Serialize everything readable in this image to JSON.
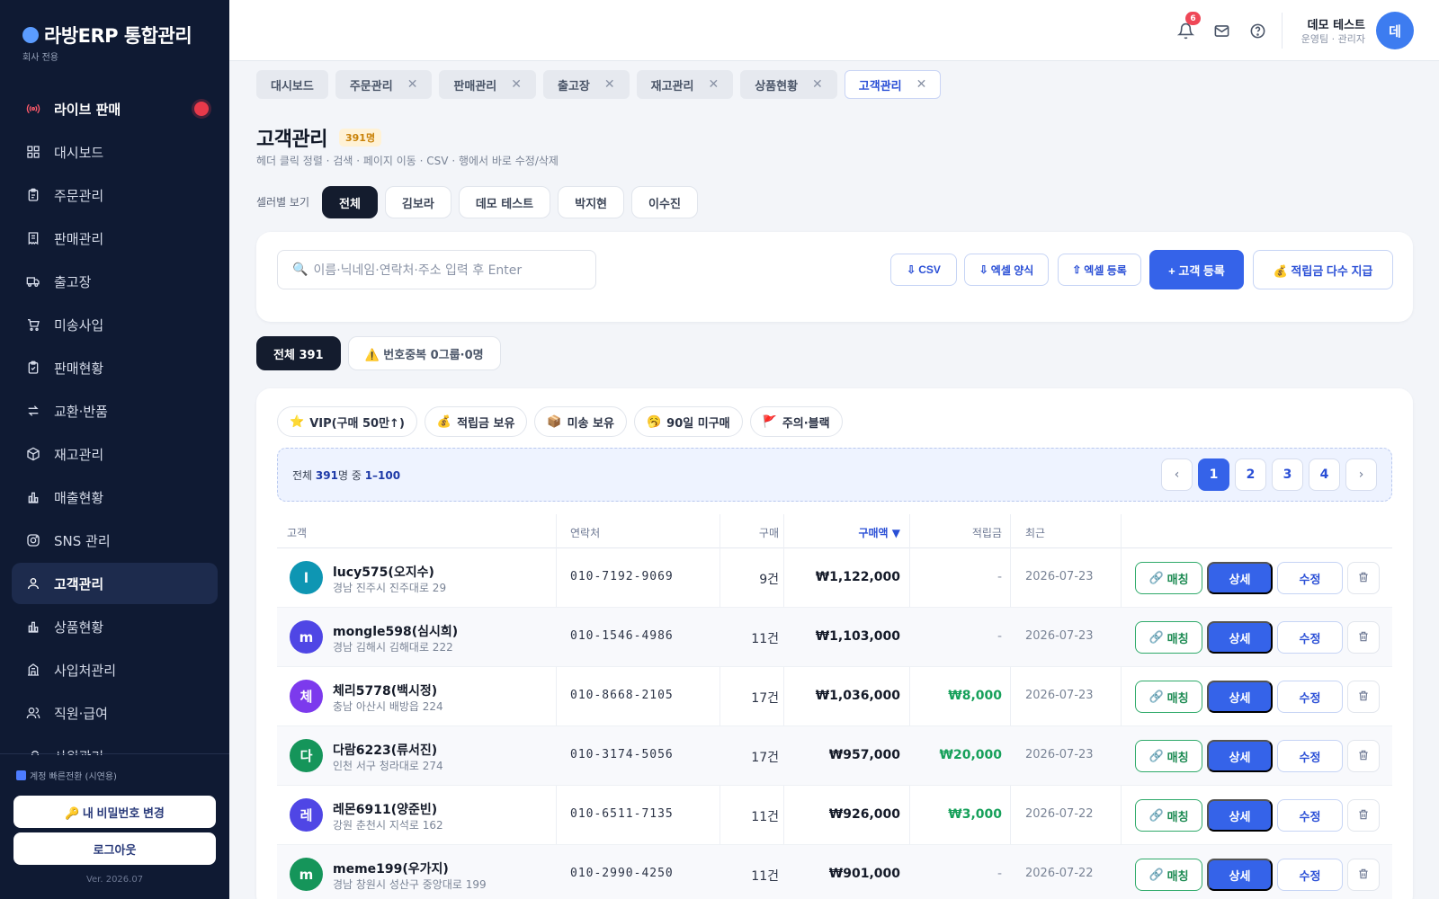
{
  "app": {
    "title": "라방ERP 통합관리",
    "subtitle": "회사 전용"
  },
  "sidebar": {
    "items": [
      {
        "label": "라이브 판매",
        "icon": "live-broadcast-icon"
      },
      {
        "label": "대시보드",
        "icon": "dashboard-grid-icon"
      },
      {
        "label": "주문관리",
        "icon": "clipboard-icon"
      },
      {
        "label": "판매관리",
        "icon": "receipt-icon"
      },
      {
        "label": "출고장",
        "icon": "truck-icon"
      },
      {
        "label": "미송사입",
        "icon": "cart-icon"
      },
      {
        "label": "판매현황",
        "icon": "clipboard-check-icon"
      },
      {
        "label": "교환·반품",
        "icon": "swap-arrows-icon"
      },
      {
        "label": "재고관리",
        "icon": "box-icon"
      },
      {
        "label": "매출현황",
        "icon": "bar-chart-icon"
      },
      {
        "label": "SNS 관리",
        "icon": "instagram-icon"
      },
      {
        "label": "고객관리",
        "icon": "user-icon"
      },
      {
        "label": "상품현황",
        "icon": "bar-chart-icon"
      },
      {
        "label": "사입처관리",
        "icon": "building-icon"
      },
      {
        "label": "직원·급여",
        "icon": "users-icon"
      },
      {
        "label": "사원관리",
        "icon": "key-icon"
      }
    ],
    "active_index": 11,
    "switch_label": "계정 빠른전환 (시연용)",
    "password_button": "🔑 내 비밀번호 변경",
    "logout_button": "로그아웃",
    "version": "Ver. 2026.07"
  },
  "header": {
    "notification_count": "6",
    "user_name": "데모 테스트",
    "user_role": "운영팀 · 관리자",
    "avatar_initial": "데"
  },
  "tabs": [
    {
      "label": "대시보드",
      "closable": false
    },
    {
      "label": "주문관리",
      "closable": true
    },
    {
      "label": "판매관리",
      "closable": true
    },
    {
      "label": "출고장",
      "closable": true
    },
    {
      "label": "재고관리",
      "closable": true
    },
    {
      "label": "상품현황",
      "closable": true
    },
    {
      "label": "고객관리",
      "closable": true,
      "active": true
    }
  ],
  "page": {
    "title": "고객관리",
    "count": "391명",
    "description": "헤더 클릭 정렬 · 검색 · 페이지 이동 · CSV · 행에서 바로 수정/삭제"
  },
  "seller_filter": {
    "label": "셀러별 보기",
    "options": [
      "전체",
      "김보라",
      "데모 테스트",
      "박지현",
      "이수진"
    ],
    "active": "전체"
  },
  "search": {
    "placeholder": "이름·닉네임·연락처·주소 입력 후 Enter",
    "csv": "CSV",
    "excel_form": "엑셀 양식",
    "excel_upload": "엑셀 등록",
    "add_customer": "+ 고객 등록",
    "bulk_points": "💰 적립금 다수 지급"
  },
  "dup_tabs": {
    "all": "전체 391",
    "duplicates": "⚠️ 번호중복 0그룹·0명"
  },
  "filters": [
    {
      "emoji": "⭐",
      "label": "VIP(구매 50만↑)"
    },
    {
      "emoji": "💰",
      "label": "적립금 보유"
    },
    {
      "emoji": "📦",
      "label": "미송 보유"
    },
    {
      "emoji": "🥱",
      "label": "90일 미구매"
    },
    {
      "emoji": "🚩",
      "label": "주의·블랙"
    }
  ],
  "pager": {
    "prefix": "전체 ",
    "total": "391",
    "mid": "명 중 ",
    "range": "1–100",
    "pages": [
      "1",
      "2",
      "3",
      "4"
    ],
    "current": "1",
    "prev": "‹",
    "next": "›"
  },
  "table": {
    "headers": {
      "customer": "고객",
      "phone": "연락처",
      "count": "구매",
      "amount": "구매액 ▼",
      "points": "적립금",
      "recent": "최근"
    },
    "row_actions": {
      "match": "매칭",
      "detail": "상세",
      "edit": "수정"
    },
    "rows": [
      {
        "initial": "l",
        "color": "#0e96b3",
        "name": "lucy575(오지수)",
        "address": "경남 진주시 진주대로 29",
        "phone": "010-7192-9069",
        "count": "9건",
        "amount": "₩1,122,000",
        "points": "-",
        "recent": "2026-07-23"
      },
      {
        "initial": "m",
        "color": "#4f46e5",
        "name": "mongle598(심시희)",
        "address": "경남 김해시 김해대로 222",
        "phone": "010-1546-4986",
        "count": "11건",
        "amount": "₩1,103,000",
        "points": "-",
        "recent": "2026-07-23"
      },
      {
        "initial": "체",
        "color": "#7c3aed",
        "name": "체리5778(백시정)",
        "address": "충남 아산시 배방읍 224",
        "phone": "010-8668-2105",
        "count": "17건",
        "amount": "₩1,036,000",
        "points": "₩8,000",
        "recent": "2026-07-23"
      },
      {
        "initial": "다",
        "color": "#15955a",
        "name": "다람6223(류서진)",
        "address": "인천 서구 청라대로 274",
        "phone": "010-3174-5056",
        "count": "17건",
        "amount": "₩957,000",
        "points": "₩20,000",
        "recent": "2026-07-23"
      },
      {
        "initial": "레",
        "color": "#4f46e5",
        "name": "레몬6911(양준빈)",
        "address": "강원 춘천시 지석로 162",
        "phone": "010-6511-7135",
        "count": "11건",
        "amount": "₩926,000",
        "points": "₩3,000",
        "recent": "2026-07-22"
      },
      {
        "initial": "m",
        "color": "#15955a",
        "name": "meme199(우가지)",
        "address": "경남 창원시 성산구 중앙대로 199",
        "phone": "010-2990-4250",
        "count": "11건",
        "amount": "₩901,000",
        "points": "-",
        "recent": "2026-07-22"
      }
    ]
  }
}
